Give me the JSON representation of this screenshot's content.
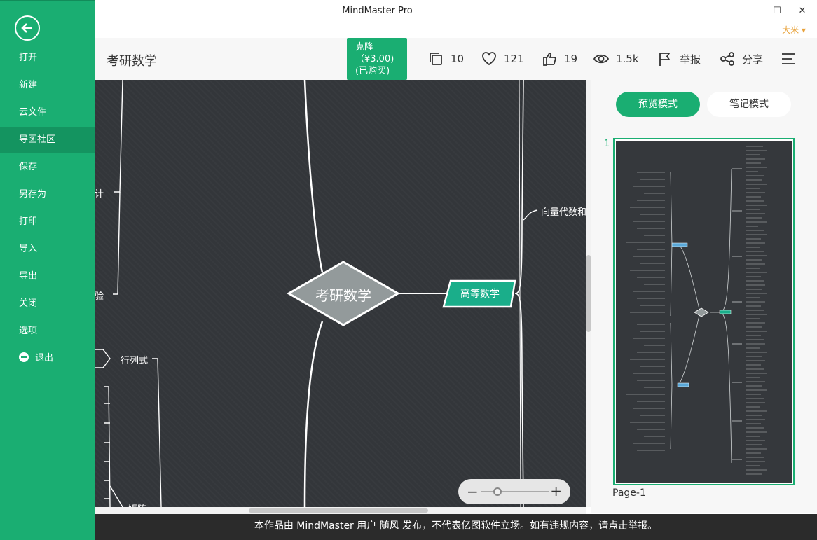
{
  "window": {
    "title": "MindMaster Pro",
    "minimize": "—",
    "maximize": "☐",
    "close": "✕",
    "user": "大米 ▾"
  },
  "sidebar": {
    "items": [
      {
        "label": "打开"
      },
      {
        "label": "新建"
      },
      {
        "label": "云文件"
      },
      {
        "label": "导图社区"
      },
      {
        "label": "保存"
      },
      {
        "label": "另存为"
      },
      {
        "label": "打印"
      },
      {
        "label": "导入"
      },
      {
        "label": "导出"
      },
      {
        "label": "关闭"
      },
      {
        "label": "选项"
      },
      {
        "label": "退出"
      }
    ],
    "active_index": 3
  },
  "header": {
    "title": "考研数学",
    "clone": {
      "line1": "克隆",
      "line2": "（¥3.00)",
      "line3": "(已购买)"
    },
    "copies": "10",
    "likes": "121",
    "thumbs": "19",
    "views": "1.5k",
    "report": "举报",
    "share": "分享"
  },
  "canvas": {
    "root": "考研数学",
    "main_topic": "高等数学",
    "labels": {
      "left1": "计",
      "left2": "验",
      "determinant": "行列式",
      "matrix": "矩阵",
      "right1": "向量代数和空"
    },
    "zoom_minus": "−",
    "zoom_plus": "+"
  },
  "right_panel": {
    "preview_mode": "预览模式",
    "note_mode": "笔记模式",
    "page_number": "1",
    "page_label": "Page-1"
  },
  "footer": {
    "notice": "本作品由 MindMaster 用户 随风 发布，不代表亿图软件立场。如有违规内容，请点击举报。"
  },
  "colors": {
    "accent": "#1aae72",
    "canvas_bg": "#33363a",
    "footer_bg": "#2b2b2b"
  }
}
